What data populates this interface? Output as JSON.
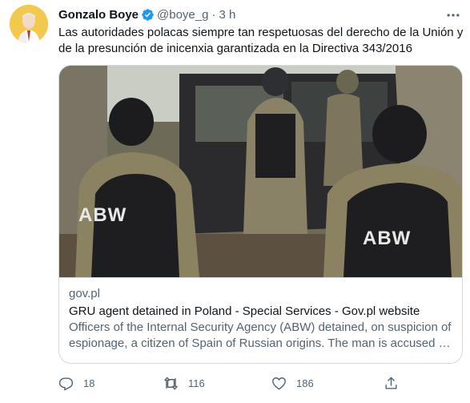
{
  "tweet": {
    "author_name": "Gonzalo Boye",
    "handle": "@boye_g",
    "separator": "·",
    "time": "3 h",
    "text": "Las autoridades polacas siempre tan respetuosas del derecho de la Unión y de la presunción de inicenxia garantizada en la Directiva 343/2016"
  },
  "card": {
    "domain": "gov.pl",
    "title": "GRU agent detained in Poland - Special Services - Gov.pl website",
    "description": "Officers of the Internal Security Agency (ABW) detained, on suspicion of espionage, a citizen of Spain of Russian origins. The man is accused of acting to the detriment of Poland.",
    "image_vest_label_left": "ABW",
    "image_vest_label_right": "ABW"
  },
  "actions": {
    "replies": "18",
    "retweets": "116",
    "likes": "186"
  },
  "icons": {
    "verified": "verified-badge-icon",
    "more": "more-icon",
    "reply": "reply-icon",
    "retweet": "retweet-icon",
    "like": "like-icon",
    "share": "share-icon"
  },
  "colors": {
    "verified": "#1d9bf0",
    "text": "#0f1419",
    "secondary": "#536471",
    "border": "#cfd9de"
  }
}
